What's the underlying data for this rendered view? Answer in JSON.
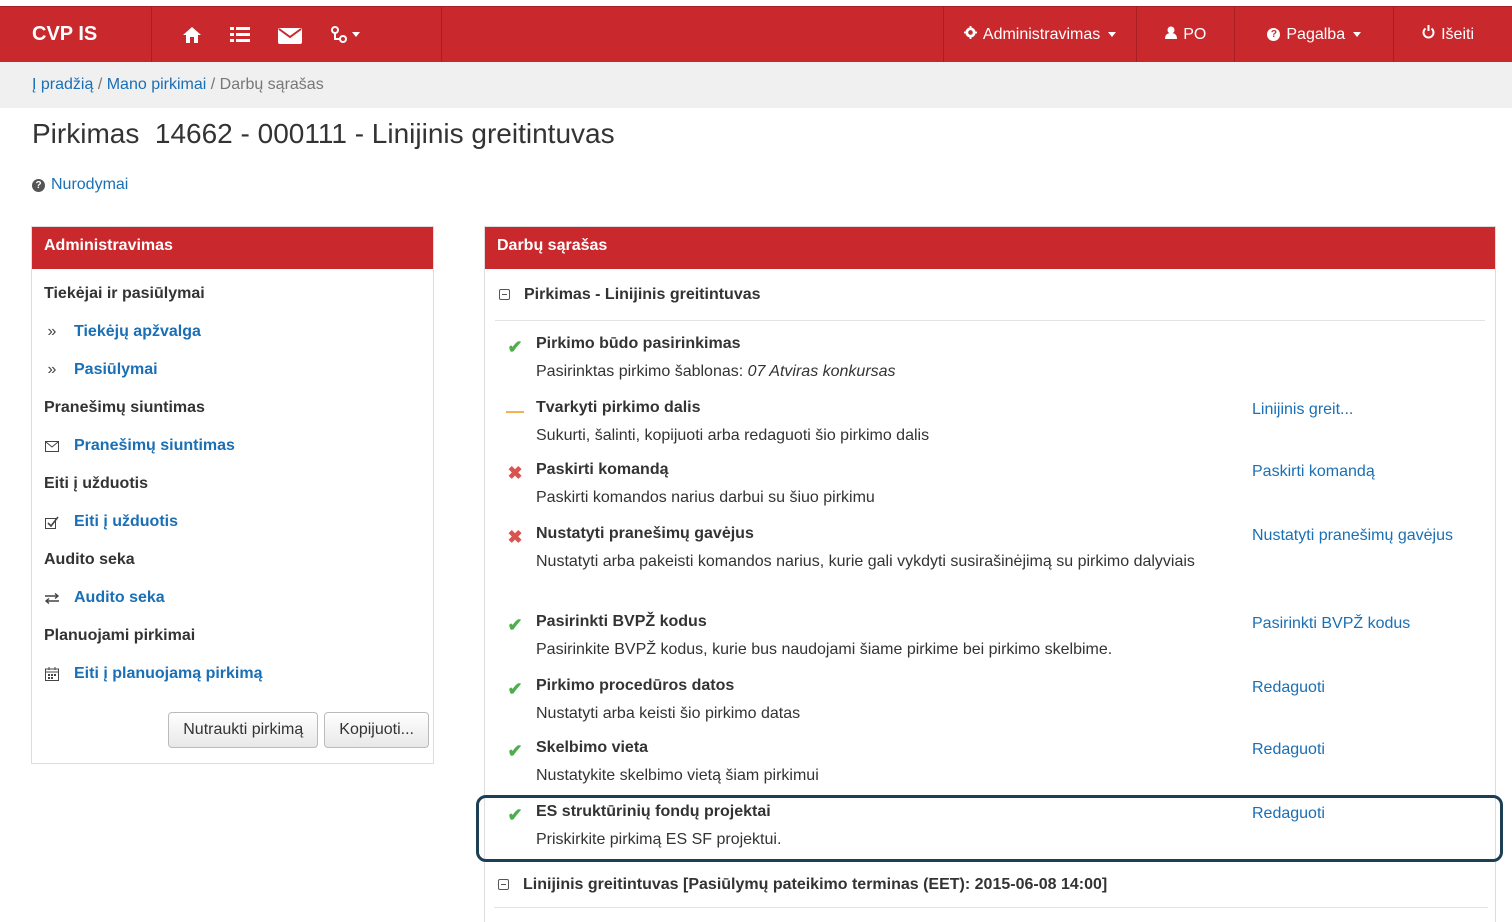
{
  "topbar": {
    "brand": "CVP IS",
    "admin_label": "Administravimas",
    "user_label": "PO",
    "help_label": "Pagalba",
    "logout_label": "Išeiti"
  },
  "breadcrumb": {
    "home": "Į pradžią",
    "sep1": " / ",
    "my_purchases": "Mano pirkimai",
    "sep2": " / ",
    "current": "Darbų sąrašas"
  },
  "page": {
    "title": "Pirkimas  14662 - 000111 - Linijinis greitintuvas",
    "guide_link": "Nurodymai"
  },
  "admin_panel": {
    "heading": "Administravimas",
    "groups": [
      {
        "title": "Tiekėjai ir pasiūlymai"
      },
      {
        "title": "Pranešimų siuntimas"
      },
      {
        "title": "Eiti į užduotis"
      },
      {
        "title": "Audito seka"
      },
      {
        "title": "Planuojami pirkimai"
      }
    ],
    "links": {
      "suppliers_overview": "Tiekėjų apžvalga",
      "offers": "Pasiūlymai",
      "messaging": "Pranešimų siuntimas",
      "go_tasks": "Eiti į užduotis",
      "audit": "Audito seka",
      "planned": "Eiti į planuojamą pirkimą"
    },
    "buttons": {
      "cancel": "Nutraukti pirkimą",
      "copy": "Kopijuoti..."
    }
  },
  "tasks_panel": {
    "heading": "Darbų sąrašas",
    "procurement_header": "Pirkimas - Linijinis greitintuvas",
    "tasks": [
      {
        "status": "done",
        "title": "Pirkimo būdo pasirinkimas",
        "desc_prefix": "Pasirinktas pirkimo šablonas: ",
        "desc_em": "07 Atviras konkursas",
        "action": ""
      },
      {
        "status": "partial",
        "title": "Tvarkyti pirkimo dalis",
        "desc": "Sukurti, šalinti, kopijuoti arba redaguoti šio pirkimo dalis",
        "action": "Linijinis greit..."
      },
      {
        "status": "todo",
        "title": "Paskirti komandą",
        "desc": "Paskirti komandos narius darbui su šiuo pirkimu",
        "action": "Paskirti komandą"
      },
      {
        "status": "todo",
        "title": "Nustatyti pranešimų gavėjus",
        "desc": "Nustatyti arba pakeisti komandos narius, kurie gali vykdyti susirašinėjimą su pirkimo dalyviais",
        "action": "Nustatyti pranešimų gavėjus"
      },
      {
        "status": "done",
        "title": "Pasirinkti BVPŽ kodus",
        "desc": "Pasirinkite BVPŽ kodus, kurie bus naudojami šiame pirkime bei pirkimo skelbime.",
        "action": "Pasirinkti BVPŽ kodus"
      },
      {
        "status": "done",
        "title": "Pirkimo procedūros datos",
        "desc": "Nustatyti arba keisti šio pirkimo datas",
        "action": "Redaguoti"
      },
      {
        "status": "done",
        "title": "Skelbimo vieta",
        "desc": "Nustatykite skelbimo vietą šiam pirkimui",
        "action": "Redaguoti"
      },
      {
        "status": "done",
        "title": "ES struktūrinių fondų projektai",
        "desc": "Priskirkite pirkimą ES SF projektui.",
        "action": "Redaguoti"
      }
    ],
    "lot_header": "Linijinis greitintuvas [Pasiūlymų pateikimo terminas (EET): 2015-06-08 14:00]"
  },
  "status_icons": {
    "done": "check-icon",
    "partial": "dash-icon",
    "todo": "cross-icon"
  },
  "colors": {
    "brand": "#c9282d",
    "link": "#1a6fb5",
    "ok": "#4cae4c",
    "warn": "#f0ad4e",
    "err": "#d9534f",
    "highlight": "#1c3f55"
  }
}
